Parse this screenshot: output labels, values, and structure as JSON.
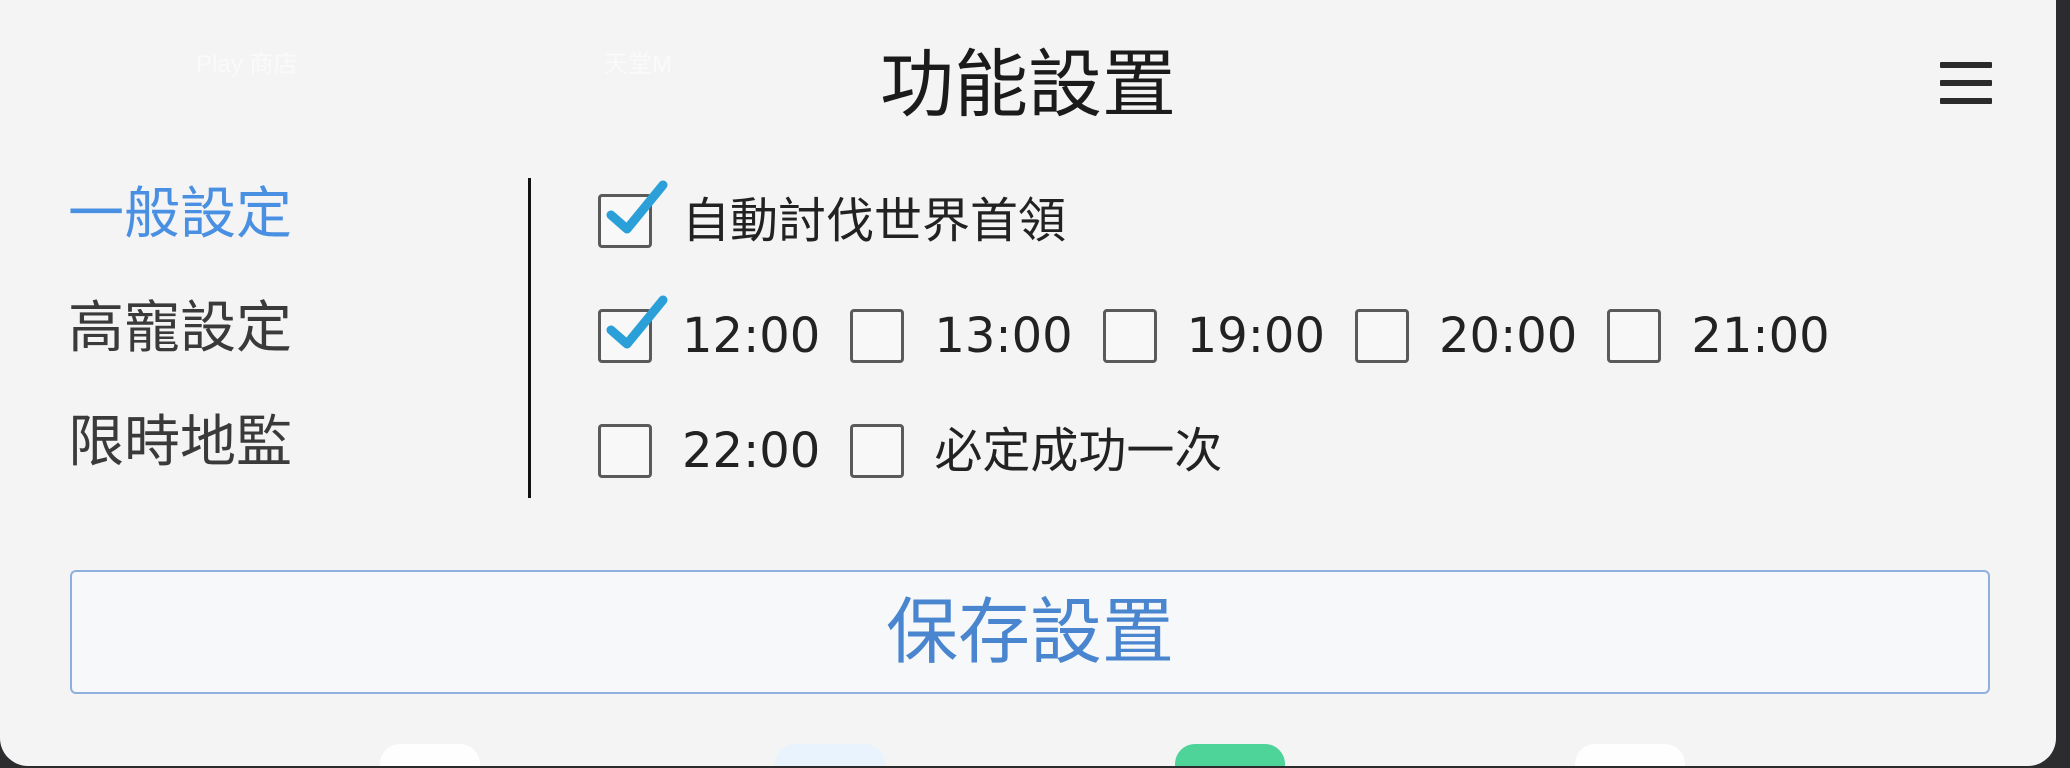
{
  "background_labels": {
    "play_store": "Play 商店",
    "lineage": "天堂M"
  },
  "dialog": {
    "title": "功能設置"
  },
  "nav": {
    "items": [
      {
        "label": "一般設定",
        "active": true
      },
      {
        "label": "高寵設定",
        "active": false
      },
      {
        "label": "限時地監",
        "active": false
      }
    ]
  },
  "options": {
    "auto_boss": {
      "label": "自動討伐世界首領",
      "checked": true
    },
    "times": [
      {
        "label": "12:00",
        "checked": true
      },
      {
        "label": "13:00",
        "checked": false
      },
      {
        "label": "19:00",
        "checked": false
      },
      {
        "label": "20:00",
        "checked": false
      },
      {
        "label": "21:00",
        "checked": false
      },
      {
        "label": "22:00",
        "checked": false
      }
    ],
    "must_succeed": {
      "label": "必定成功一次",
      "checked": false
    }
  },
  "save_button": {
    "label": "保存設置"
  },
  "colors": {
    "accent": "#4a90e2",
    "checkmark": "#2a9fd8",
    "panel_bg": "#f4f4f5",
    "button_text": "#4a86cf"
  },
  "icons": {
    "menu": "hamburger-menu-icon",
    "check": "checkmark-icon"
  }
}
